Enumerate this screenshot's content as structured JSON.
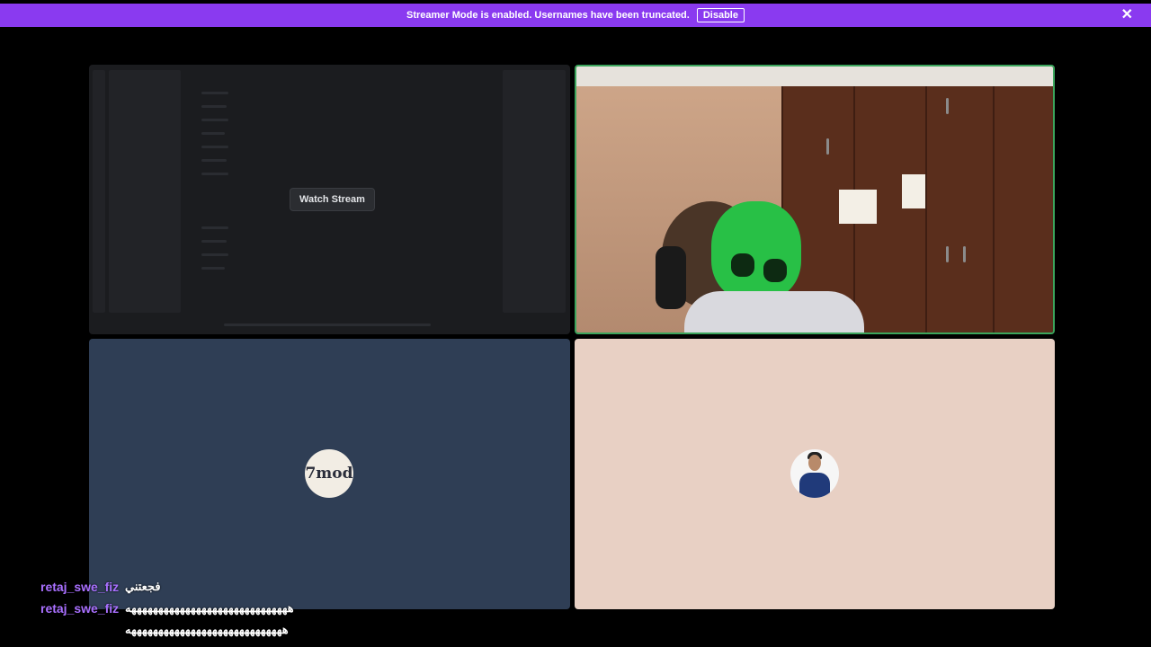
{
  "banner": {
    "text": "Streamer Mode is enabled. Usernames have been truncated.",
    "disable_label": "Disable",
    "close_glyph": "✕",
    "color": "#8a3af0"
  },
  "tiles": {
    "stream": {
      "watch_label": "Watch Stream"
    },
    "camera": {
      "border_color": "#3ba55c"
    },
    "user_7mod": {
      "avatar_text": "7mod",
      "background": "#2f3e55"
    },
    "user_4": {
      "background": "#e8d0c4"
    }
  },
  "chat": [
    {
      "user": "retaj_swe_fiz",
      "message": "فجعتني"
    },
    {
      "user": "retaj_swe_fiz",
      "message": "ههههههههههههههههههههههههههههههه",
      "continuation": "هههههههههههههههههههههههههههههه"
    }
  ]
}
